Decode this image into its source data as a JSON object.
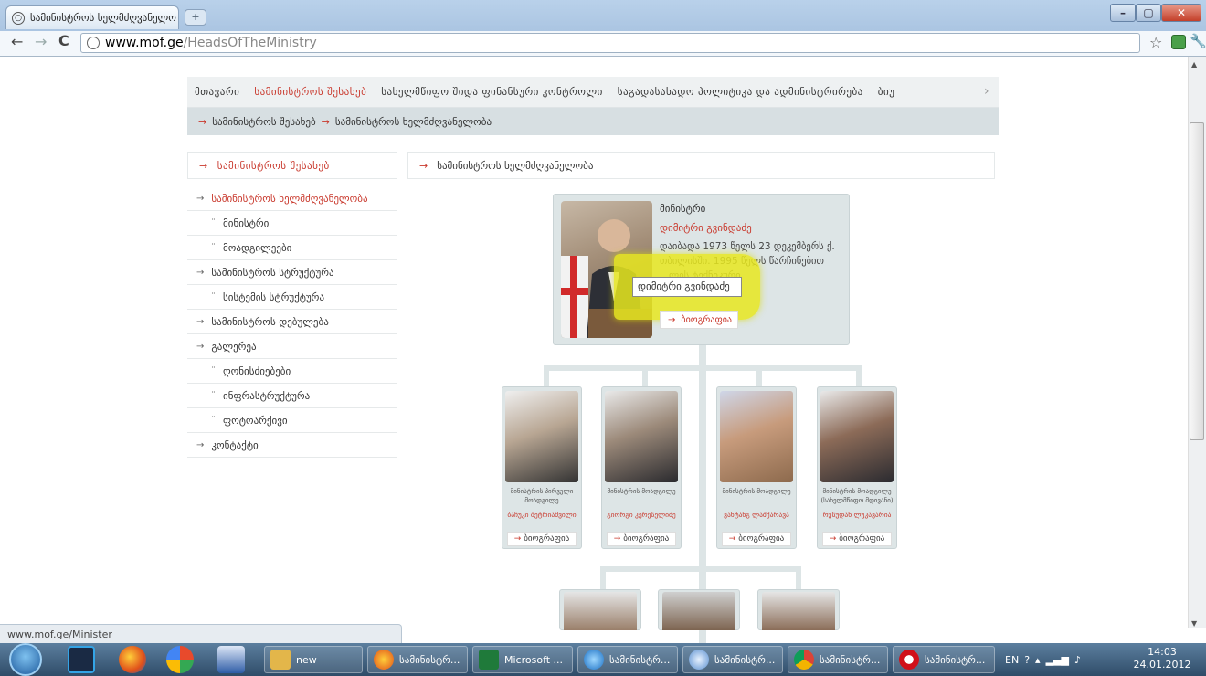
{
  "browser": {
    "tab_title": "სამინისტროს ხელმძღვანელო",
    "tab_close": "×",
    "new_tab": "+",
    "url_host": "www.mof.ge",
    "url_path": "/HeadsOfTheMinistry",
    "icons": {
      "back": "back-arrow-icon",
      "forward": "forward-arrow-icon",
      "reload": "reload-icon",
      "star": "star-icon",
      "wrench": "wrench-icon"
    }
  },
  "window_controls": {
    "minimize": "–",
    "maximize": "▢",
    "close": "✕"
  },
  "top_menu": {
    "items": [
      "მთავარი",
      "სამინისტროს შესახებ",
      "სახელმწიფო შიდა ფინანსური კონტროლი",
      "საგადასახადო პოლიტიკა და ადმინისტრირება",
      "ბიუ"
    ],
    "active_index": 1,
    "more": "›"
  },
  "breadcrumb": [
    "სამინისტროს შესახებ",
    "სამინისტროს ხელმძღვანელობა"
  ],
  "sidebar": {
    "header": "სამინისტროს შესახებ",
    "items": [
      {
        "label": "სამინისტროს ხელმძღვანელობა",
        "level": 1,
        "active": true
      },
      {
        "label": "მინისტრი",
        "level": 2
      },
      {
        "label": "მოადგილეები",
        "level": 2
      },
      {
        "label": "სამინისტროს სტრუქტურა",
        "level": 1
      },
      {
        "label": "სისტემის სტრუქტურა",
        "level": 2
      },
      {
        "label": "სამინისტროს დებულება",
        "level": 1
      },
      {
        "label": "გალერეა",
        "level": 1
      },
      {
        "label": "ღონისძიებები",
        "level": 2
      },
      {
        "label": "ინფრასტრუქტურა",
        "level": 2
      },
      {
        "label": "ფოტოარქივი",
        "level": 2
      },
      {
        "label": "კონტაქტი",
        "level": 1
      }
    ]
  },
  "content": {
    "header": "სამინისტროს ხელმძღვანელობა",
    "minister": {
      "title": "მინისტრი",
      "name": "დიმიტრი გვინდაძე",
      "bio": "დაიბადა 1973 წელს 23 დეკემბერს ქ. თბილისში. 1995 წელს წარჩინებით ...ლის ტექნიკური",
      "bio_button": "ბიოგრაფია",
      "tooltip": "დიმიტრი გვინდაძე"
    },
    "deputies": [
      {
        "role": "მინისტრის პირველი მოადგილე",
        "name": "ბაჩუკი ბეტრიაშვილი",
        "bio_button": "ბიოგრაფია"
      },
      {
        "role": "მინისტრის მოადგილე",
        "name": "გიორგი კერესელიძე",
        "bio_button": "ბიოგრაფია"
      },
      {
        "role": "მინისტრის მოადგილე",
        "name": "ვახტანგ ლაშქარავა",
        "bio_button": "ბიოგრაფია"
      },
      {
        "role": "მინისტრის მოადგილე (სახელმწიფო მდივანი)",
        "name": "რუსუდან ლუკავარია",
        "bio_button": "ბიოგრაფია"
      }
    ]
  },
  "status_bar": "www.mof.ge/Minister",
  "taskbar": {
    "tasks": [
      {
        "label": "new"
      },
      {
        "label": "სამინისტრ..."
      },
      {
        "label": "Microsoft ..."
      },
      {
        "label": "სამინისტრ..."
      },
      {
        "label": "სამინისტრ..."
      },
      {
        "label": "სამინისტრ..."
      },
      {
        "label": "სამინისტრ..."
      }
    ],
    "tray_lang": "EN",
    "time": "14:03",
    "date": "24.01.2012"
  }
}
